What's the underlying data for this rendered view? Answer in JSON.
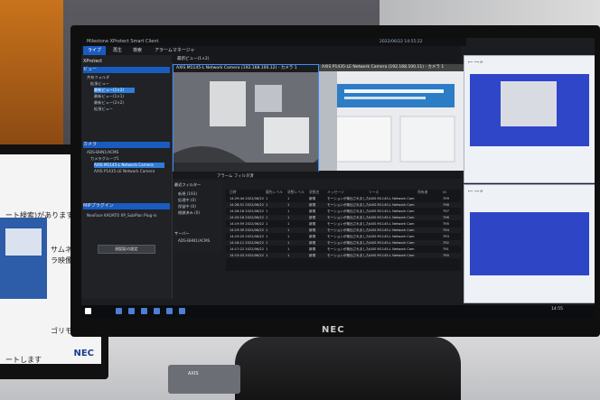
{
  "left_screen": {
    "line1": "ート検索)があります。",
    "line2": "サムネイル",
    "line3": "ラ映像を再生",
    "line4": "ゴリモー",
    "line5": "ートします",
    "brand": "NEC"
  },
  "monitor": {
    "brand": "NEC"
  },
  "app": {
    "title": "Milestone XProtect Smart Client",
    "clock": "2022/06/22 14:55:22",
    "menus": [
      "ライブ",
      "再生",
      "検索",
      "アラームマネージャ"
    ],
    "active_menu": "ライブ",
    "sidebar": {
      "header_xprotect": "XProtect",
      "header_views": "ビュー",
      "items_views": [
        "共有フォルダ",
        "拡張ビュー",
        "最新ビュー(1×2)",
        "最新ビュー(1×1)",
        "最新ビュー(2×2)",
        "拡張ビュー"
      ],
      "header_cameras": "カメラ",
      "items_cameras": [
        "ADS-BHN1/ACMS",
        "カメラグループ1",
        "AXIS M1145-L Network Camera",
        "AXIS P1435-LE Network Camera"
      ],
      "header_plugin": "MIPプラグイン",
      "plugin_name": "NeoFace KAOATO XP_SubPlan Plug-in",
      "plugin_button": "顔認証の設定"
    },
    "view_tab": "最新ビュー(1×2)",
    "cameras": [
      {
        "title": "AXIS M1145-L Network Camera (192.168.100.12) - カメラ 1"
      },
      {
        "title": "AXIS P1435-LE Network Camera (192.168.100.11) - カメラ 1"
      }
    ],
    "alarm": {
      "tabs": "アラーム  フィルタ済",
      "filter_header": "最近フィルター",
      "filters": [
        "新規 (193)",
        "処理中 (0)",
        "保留中 (0)",
        "閉鎖済み (0)"
      ],
      "server_header": "サーバー",
      "server_name": "ADS-BHN1/ACMS",
      "columns": [
        "日時",
        "優先レベル",
        "状態レベル",
        "状態名",
        "メッセージ",
        "ソース",
        "所有者",
        "ID"
      ],
      "rows": [
        [
          "14:29:44 2022/06/22",
          "1",
          "1",
          "新規",
          "モーションが検出されました",
          "AXIS M1145-L Network Cam",
          "",
          "799"
        ],
        [
          "14:28:51 2022/06/22",
          "1",
          "1",
          "新規",
          "モーションが検出されました",
          "AXIS M1145-L Network Cam",
          "",
          "798"
        ],
        [
          "14:28:18 2022/06/22",
          "1",
          "1",
          "新規",
          "モーションが検出されました",
          "AXIS M1145-L Network Cam",
          "",
          "797"
        ],
        [
          "14:20:18 2022/06/22",
          "1",
          "1",
          "新規",
          "モーションが検出されました",
          "AXIS M1145-L Network Cam",
          "",
          "796"
        ],
        [
          "14:19:59 2022/06/22",
          "1",
          "1",
          "新規",
          "モーションが検出されました",
          "AXIS M1145-L Network Cam",
          "",
          "795"
        ],
        [
          "14:19:39 2022/06/22",
          "1",
          "1",
          "新規",
          "モーションが検出されました",
          "AXIS M1145-L Network Cam",
          "",
          "794"
        ],
        [
          "14:19:20 2022/06/22",
          "1",
          "1",
          "新規",
          "モーションが検出されました",
          "AXIS M1145-L Network Cam",
          "",
          "793"
        ],
        [
          "14:18:11 2022/06/22",
          "1",
          "1",
          "新規",
          "モーションが検出されました",
          "AXIS M1145-L Network Cam",
          "",
          "792"
        ],
        [
          "14:17:22 2022/06/22",
          "1",
          "1",
          "新規",
          "モーションが検出されました",
          "AXIS M1145-L Network Cam",
          "",
          "791"
        ],
        [
          "14:15:03 2022/06/22",
          "1",
          "1",
          "新規",
          "モーションが検出されました",
          "AXIS M1145-L Network Cam",
          "",
          "790"
        ]
      ]
    },
    "taskbar_clock": "14:55"
  },
  "gadget": {
    "label": "AXIS"
  },
  "colors": {
    "accent": "#1a5bbf",
    "browser_view": "#2f46c9"
  }
}
